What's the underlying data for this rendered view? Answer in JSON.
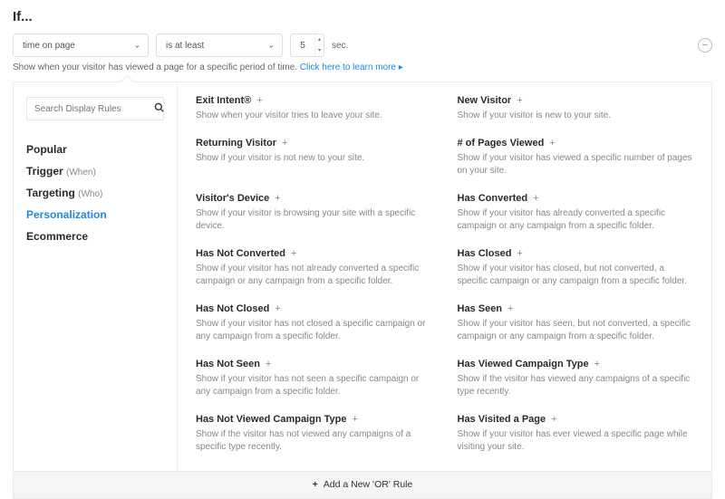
{
  "header": {
    "title": "If..."
  },
  "rulebar": {
    "field": "time on page",
    "operator": "is at least",
    "value": "5",
    "unit": "sec.",
    "helper_text": "Show when your visitor has viewed a page for a specific period of time. ",
    "helper_link": "Click here to learn more ▸"
  },
  "search": {
    "placeholder": "Search Display Rules"
  },
  "nav": {
    "items": [
      {
        "label": "Popular",
        "sub": ""
      },
      {
        "label": "Trigger",
        "sub": "(When)"
      },
      {
        "label": "Targeting",
        "sub": "(Who)"
      },
      {
        "label": "Personalization",
        "sub": "",
        "active": true
      },
      {
        "label": "Ecommerce",
        "sub": ""
      }
    ]
  },
  "rules_left": [
    {
      "title": "Exit Intent®",
      "desc": "Show when your visitor tries to leave your site."
    },
    {
      "title": "Returning Visitor",
      "desc": "Show if your visitor is not new to your site."
    },
    {
      "title": "Visitor's Device",
      "desc": "Show if your visitor is browsing your site with a specific device."
    },
    {
      "title": "Has Not Converted",
      "desc": "Show if your visitor has not already converted a specific campaign or any campaign from a specific folder."
    },
    {
      "title": "Has Not Closed",
      "desc": "Show if your visitor has not closed a specific campaign or any campaign from a specific folder."
    },
    {
      "title": "Has Not Seen",
      "desc": "Show if your visitor has not seen a specific campaign or any campaign from a specific folder."
    },
    {
      "title": "Has Not Viewed Campaign Type",
      "desc": "Show if the visitor has not viewed any campaigns of a specific type recently."
    }
  ],
  "rules_right": [
    {
      "title": "New Visitor",
      "desc": "Show if your visitor is new to your site."
    },
    {
      "title": "# of Pages Viewed",
      "desc": "Show if your visitor has viewed a specific number of pages on your site."
    },
    {
      "title": "Has Converted",
      "desc": "Show if your visitor has already converted a specific campaign or any campaign from a specific folder."
    },
    {
      "title": "Has Closed",
      "desc": "Show if your visitor has closed, but not converted, a specific campaign or any campaign from a specific folder."
    },
    {
      "title": "Has Seen",
      "desc": "Show if your visitor has seen, but not converted, a specific campaign or any campaign from a specific folder."
    },
    {
      "title": "Has Viewed Campaign Type",
      "desc": "Show if the visitor has viewed any campaigns of a specific type recently."
    },
    {
      "title": "Has Visited a Page",
      "desc": "Show if your visitor has ever viewed a specific page while visiting your site."
    }
  ],
  "footer": {
    "label": "Add a New 'OR' Rule"
  }
}
